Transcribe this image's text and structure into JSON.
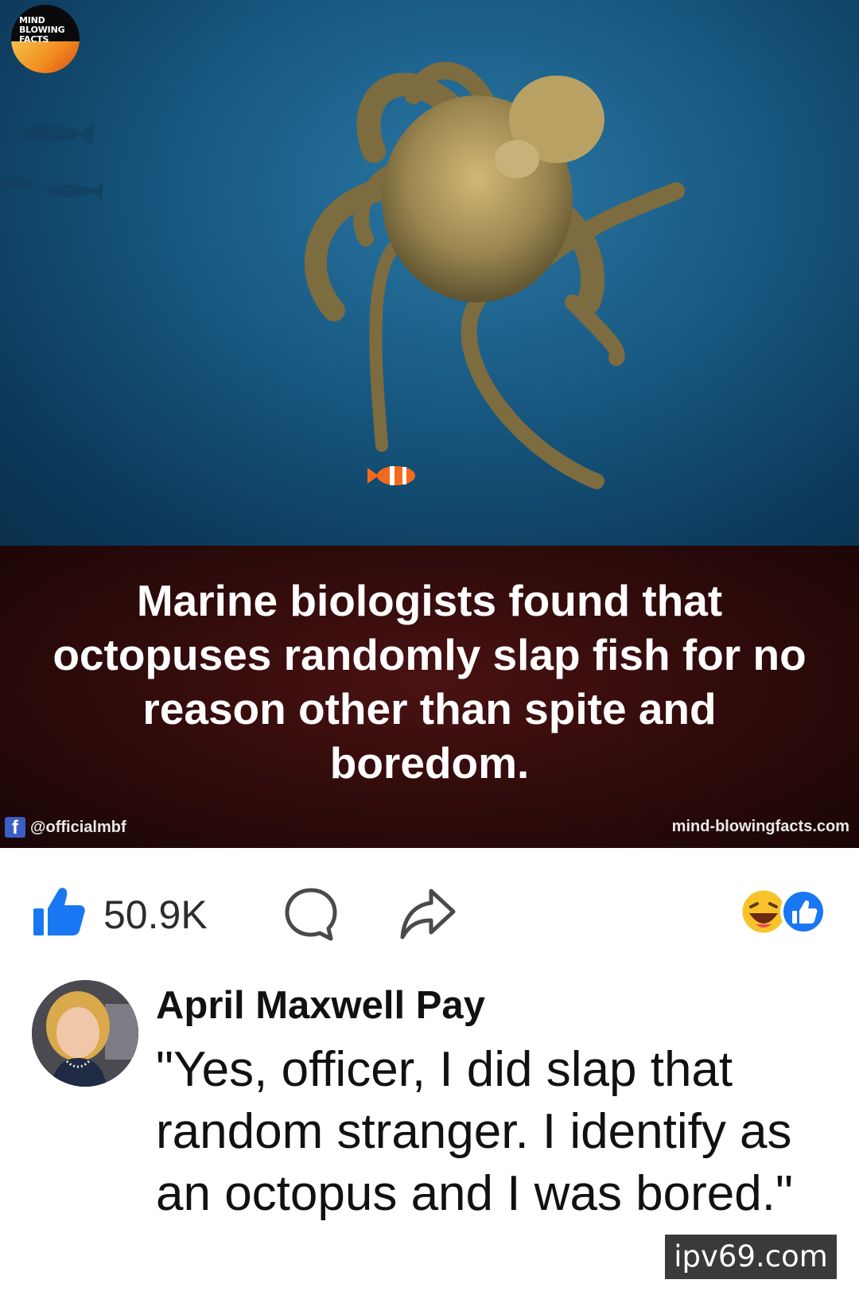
{
  "post": {
    "logo_text": [
      "MIND",
      "BLOWING",
      "FACTS"
    ],
    "headline": "Marine biologists found that octopuses randomly slap fish for no reason other than spite and boredom.",
    "handle": "@officialmbf",
    "site": "mind-blowingfacts.com"
  },
  "actions": {
    "like_count": "50.9K",
    "icons": [
      "thumbs-up-icon",
      "comment-icon",
      "share-icon"
    ],
    "reactions": [
      "laugh-reaction",
      "like-reaction"
    ]
  },
  "comment": {
    "author": "April Maxwell Pay",
    "text": "\"Yes, officer, I did slap that random stranger. I identify as an octopus  and I was bored.\""
  },
  "watermark": "ipv69.com",
  "colors": {
    "like_blue": "#1877f2",
    "banner_red": "#3a0d0d",
    "ocean_blue": "#17577f"
  }
}
